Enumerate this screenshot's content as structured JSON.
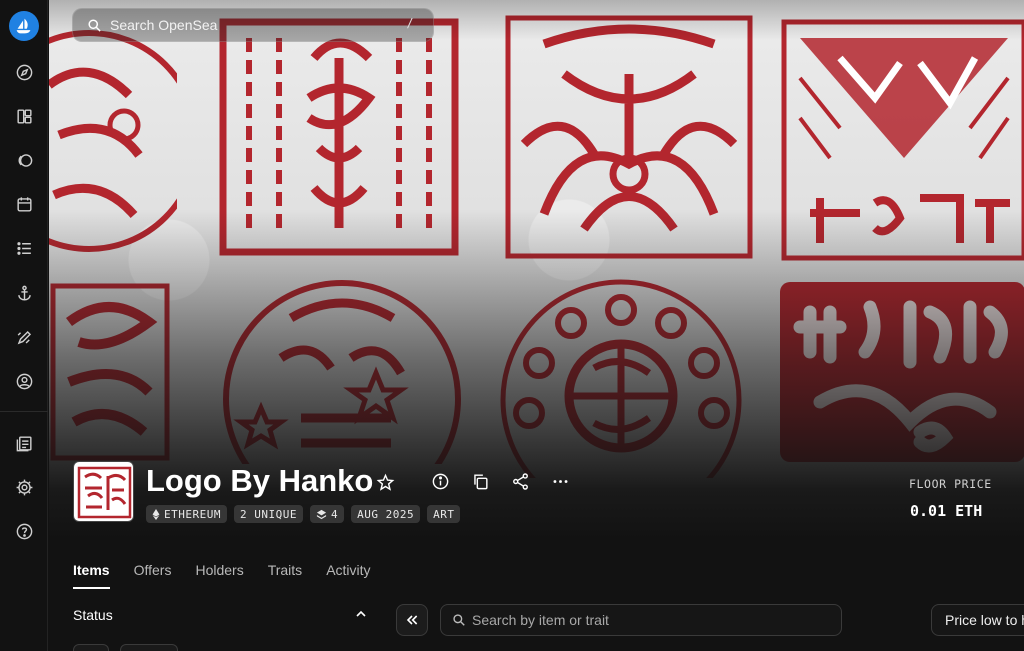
{
  "search": {
    "placeholder": "Search OpenSea",
    "shortcut": "/"
  },
  "sidebar": {
    "items": [
      {
        "icon": "compass-icon"
      },
      {
        "icon": "grid-icon"
      },
      {
        "icon": "token-icon"
      },
      {
        "icon": "calendar-icon"
      },
      {
        "icon": "list-icon"
      },
      {
        "icon": "anchor-icon"
      },
      {
        "icon": "pencil-icon"
      },
      {
        "icon": "profile-icon"
      },
      {
        "icon": "docs-icon"
      },
      {
        "icon": "gear-icon"
      },
      {
        "icon": "help-icon"
      }
    ]
  },
  "collection": {
    "name": "Logo By Hanko",
    "tags": [
      {
        "icon": "ethereum-icon",
        "label": "ETHEREUM"
      },
      {
        "icon": "",
        "label": "2 UNIQUE"
      },
      {
        "icon": "layers-icon",
        "label": "4"
      },
      {
        "icon": "",
        "label": "AUG 2025"
      },
      {
        "icon": "",
        "label": "ART"
      }
    ],
    "floor_price_label": "FLOOR PRICE",
    "floor_price_value": "0.01 ETH"
  },
  "tabs": [
    "Items",
    "Offers",
    "Holders",
    "Traits",
    "Activity"
  ],
  "filters": {
    "status_label": "Status",
    "item_search_placeholder": "Search by item or trait",
    "sort_value": "Price low to high"
  },
  "colors": {
    "accent": "#2081e2",
    "seal_red": "#b3262e",
    "background": "#121212"
  }
}
